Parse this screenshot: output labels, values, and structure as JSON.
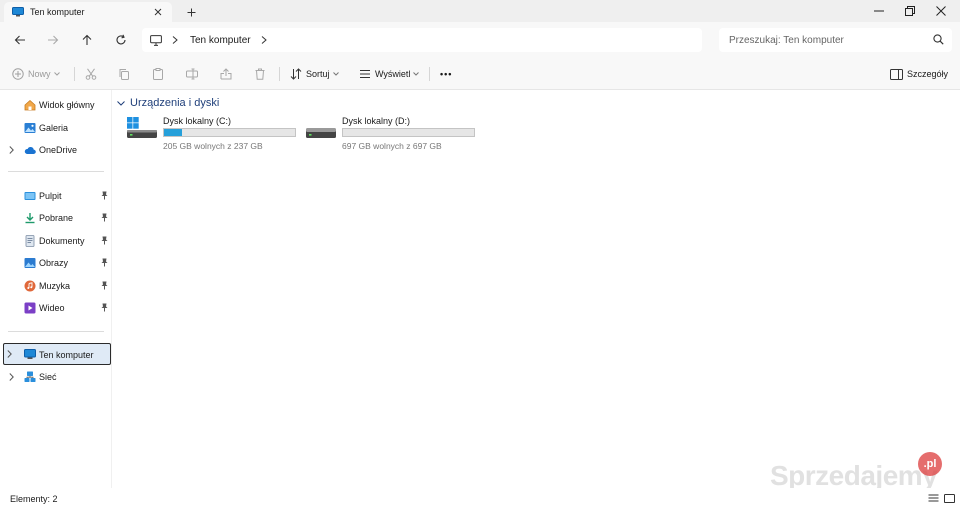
{
  "window": {
    "tab_title": "Ten komputer",
    "new_tab_symbol": "+"
  },
  "address": {
    "path": "Ten komputer",
    "search_placeholder": "Przeszukaj: Ten komputer"
  },
  "toolbar": {
    "new_label": "Nowy",
    "sort_label": "Sortuj",
    "view_label": "Wyświetl",
    "more_label": "•••",
    "details_label": "Szczegóły"
  },
  "sidebar": {
    "top": [
      {
        "label": "Widok główny",
        "icon": "home-icon"
      },
      {
        "label": "Galeria",
        "icon": "gallery-icon"
      },
      {
        "label": "OneDrive",
        "icon": "cloud-icon"
      }
    ],
    "quick_access": [
      {
        "label": "Pulpit",
        "icon": "desktop-folder-icon"
      },
      {
        "label": "Pobrane",
        "icon": "download-icon"
      },
      {
        "label": "Dokumenty",
        "icon": "documents-icon"
      },
      {
        "label": "Obrazy",
        "icon": "pictures-icon"
      },
      {
        "label": "Muzyka",
        "icon": "music-icon"
      },
      {
        "label": "Wideo",
        "icon": "video-icon"
      }
    ],
    "bottom": [
      {
        "label": "Ten komputer",
        "icon": "computer-icon",
        "selected": true
      },
      {
        "label": "Sieć",
        "icon": "network-icon"
      }
    ]
  },
  "content": {
    "group_title": "Urządzenia i dyski",
    "drives": [
      {
        "name": "Dysk lokalny (C:)",
        "free_text": "205 GB wolnych z 237 GB",
        "used_fraction": 0.135
      },
      {
        "name": "Dysk lokalny (D:)",
        "free_text": "697 GB wolnych z 697 GB",
        "used_fraction": 0.0
      }
    ]
  },
  "status": {
    "items_count": "Elementy: 2"
  },
  "watermark": {
    "text": "Sprzedajemy",
    "badge": ".pl"
  },
  "colors": {
    "accent": "#26a0da",
    "selected_bg": "#dfeaf6",
    "group_header": "#1f3f7a"
  }
}
